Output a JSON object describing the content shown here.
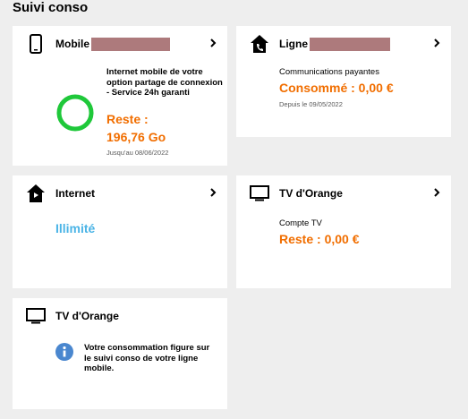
{
  "page": {
    "title": "Suivi conso"
  },
  "cards": {
    "mobile": {
      "title": "Mobile",
      "description": "Internet mobile de votre option partage de connexion - Service 24h garanti",
      "remaining_label": "Reste :",
      "remaining_value": "196,76 Go",
      "until": "Jusqu'au 08/06/2022",
      "gauge_level": 1.0,
      "gauge_color": "#1fc83a"
    },
    "ligne": {
      "title": "Ligne",
      "subtitle": "Communications payantes",
      "consumed": "Consommé : 0,00 €",
      "since": "Depuis le 09/05/2022"
    },
    "internet": {
      "title": "Internet",
      "status": "Illimité"
    },
    "tv_orange_1": {
      "title": "TV d'Orange",
      "subtitle": "Compte TV",
      "remaining": "Reste : 0,00 €"
    },
    "tv_orange_2": {
      "title": "TV d'Orange",
      "info": "Votre consommation figure sur le suivi conso de votre ligne mobile."
    }
  },
  "colors": {
    "orange": "#f16e00",
    "teal": "#4bb4e6",
    "info_blue": "#4a87cf",
    "redaction": "#ad7a7c"
  },
  "icons": [
    "mobile-phone-icon",
    "home-phone-icon",
    "home-internet-icon",
    "tv-icon",
    "chevron-right-icon",
    "info-icon"
  ]
}
